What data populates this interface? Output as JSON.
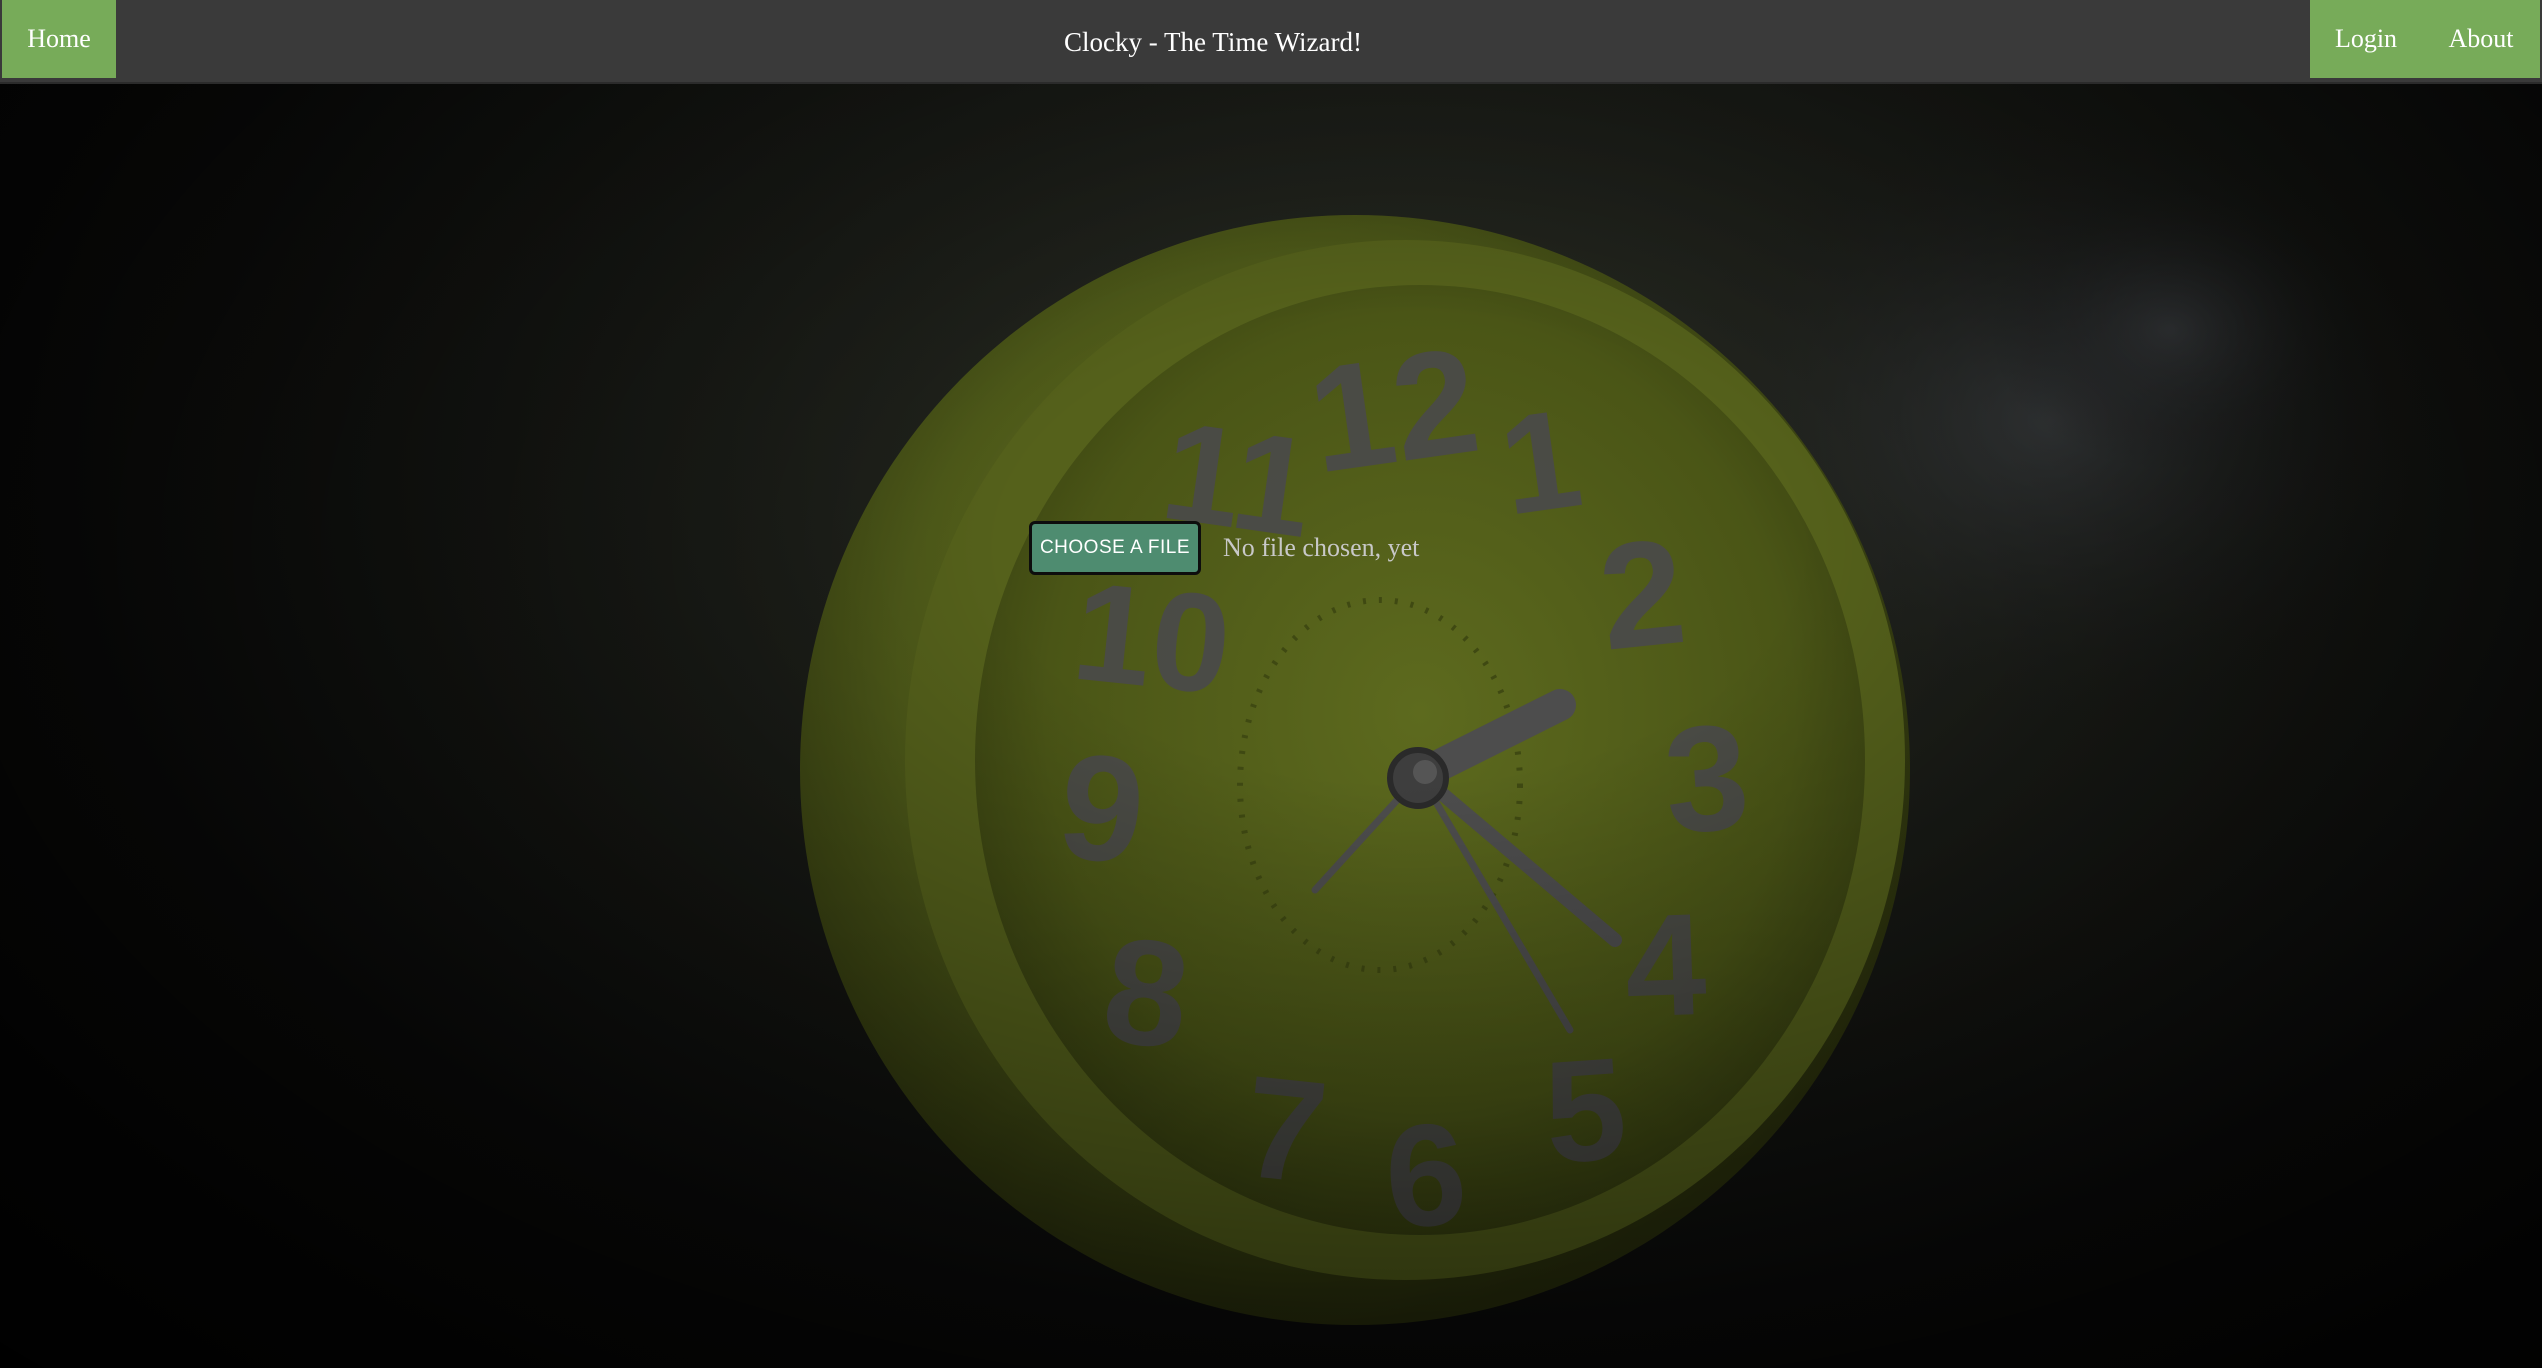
{
  "navbar": {
    "home_label": "Home",
    "title": "Clocky - The Time Wizard!",
    "login_label": "Login",
    "about_label": "About"
  },
  "file_upload": {
    "button_label": "CHOOSE A FILE",
    "status_text": "No file chosen, yet"
  },
  "background": {
    "clock_numerals": [
      "12",
      "1",
      "2",
      "3",
      "4",
      "5",
      "6",
      "7",
      "8",
      "9",
      "10",
      "11"
    ]
  },
  "colors": {
    "nav_background": "#3a3a3a",
    "nav_button": "#77ab59",
    "choose_button": "#4e8c70",
    "clock_body": "#5e6a20"
  }
}
